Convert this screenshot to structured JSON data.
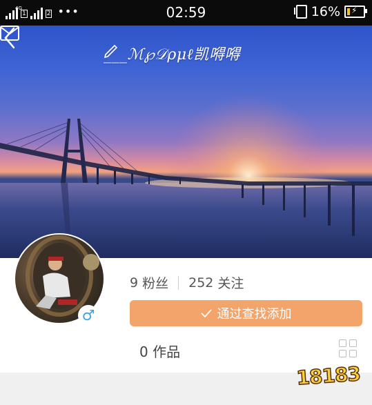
{
  "status_bar": {
    "network_label": "4G",
    "sim1": "1",
    "sim2": "2",
    "more": "•••",
    "time": "02:59",
    "battery": "16%",
    "battery_level": 0.16
  },
  "header": {
    "title": "___ℳ℘𝒟ρμℓ凯嘚嘚",
    "back_icon": "chevron-left-icon",
    "mail_icon": "envelope-icon",
    "title_icon": "pencil-icon"
  },
  "profile": {
    "followers_count": "9",
    "followers_label": "粉丝",
    "following_count": "252",
    "following_label": "关注",
    "gender_symbol": "♂",
    "add_button_label": "通过查找添加",
    "works_label": "0 作品"
  },
  "colors": {
    "accent": "#f2a46a",
    "gender": "#3fa3e0"
  },
  "watermark": "18183"
}
